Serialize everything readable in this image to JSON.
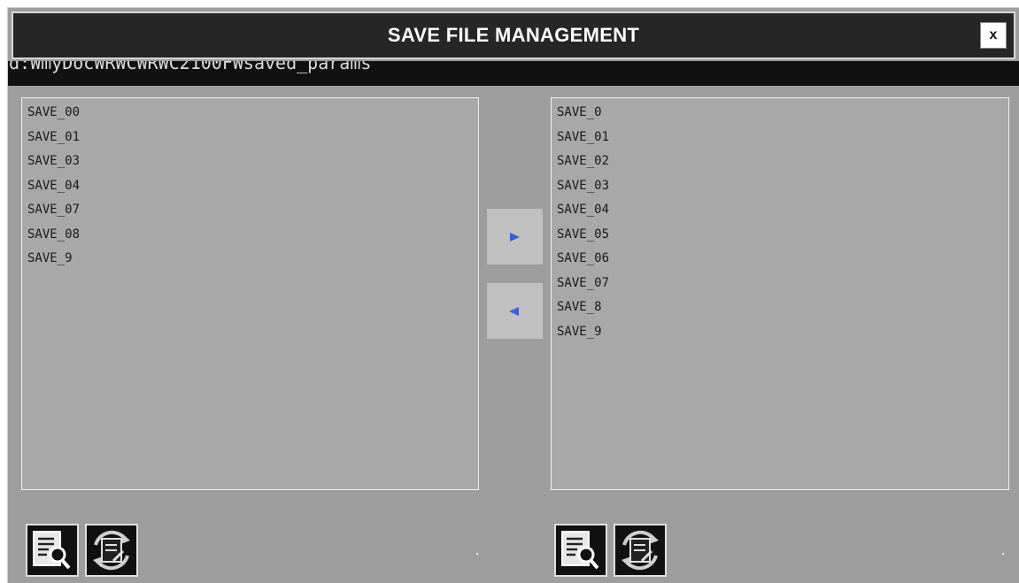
{
  "window": {
    "title": "SAVE FILE MANAGEMENT",
    "close_label": "x"
  },
  "path": {
    "text": "d:₩myDoc₩RWC₩RWC2100F₩saved_params"
  },
  "left_list": {
    "items": [
      "SAVE_00",
      "SAVE_01",
      "SAVE_03",
      "SAVE_04",
      "SAVE_07",
      "SAVE_08",
      "SAVE_9"
    ]
  },
  "right_list": {
    "items": [
      "SAVE_0",
      "SAVE_01",
      "SAVE_02",
      "SAVE_03",
      "SAVE_04",
      "SAVE_05",
      "SAVE_06",
      "SAVE_07",
      "SAVE_8",
      "SAVE_9"
    ]
  },
  "transfer": {
    "right_icon": "arrow-right-icon",
    "left_icon": "arrow-left-icon",
    "arrow_color": "#3a5ce0"
  },
  "left_tools": {
    "preview_icon": "document-search-icon",
    "refresh_icon": "document-refresh-icon"
  },
  "right_tools": {
    "preview_icon": "document-search-icon",
    "refresh_icon": "document-refresh-icon"
  },
  "colors": {
    "window_bg": "#9d9d9d",
    "titlebar_bg": "#262626",
    "pathbar_bg": "#111111",
    "listbox_bg": "#a8a8a8",
    "button_bg": "#c0c0c0"
  }
}
